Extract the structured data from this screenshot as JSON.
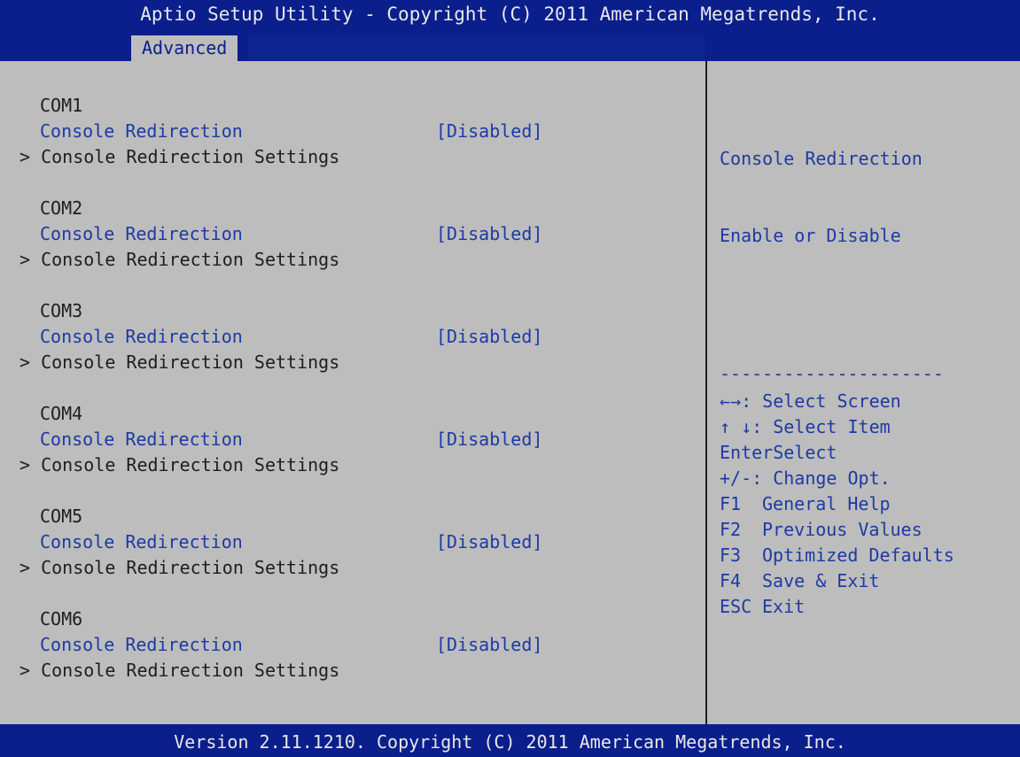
{
  "header": {
    "title": "Aptio Setup Utility - Copyright (C) 2011 American Megatrends, Inc.",
    "active_tab": "Advanced"
  },
  "groups": [
    {
      "com": "COM1",
      "option_label": "Console Redirection",
      "option_value": "[Disabled]",
      "submenu": "> Console Redirection Settings"
    },
    {
      "com": "COM2",
      "option_label": "Console Redirection",
      "option_value": "[Disabled]",
      "submenu": "> Console Redirection Settings"
    },
    {
      "com": "COM3",
      "option_label": "Console Redirection",
      "option_value": "[Disabled]",
      "submenu": "> Console Redirection Settings"
    },
    {
      "com": "COM4",
      "option_label": "Console Redirection",
      "option_value": "[Disabled]",
      "submenu": "> Console Redirection Settings"
    },
    {
      "com": "COM5",
      "option_label": "Console Redirection",
      "option_value": "[Disabled]",
      "submenu": "> Console Redirection Settings"
    },
    {
      "com": "COM6",
      "option_label": "Console Redirection",
      "option_value": "[Disabled]",
      "submenu": "> Console Redirection Settings"
    }
  ],
  "help": {
    "line1": "Console Redirection",
    "line2": "Enable or Disable"
  },
  "separator": "---------------------",
  "keys": [
    {
      "key": "←→",
      "desc": ": Select Screen"
    },
    {
      "key": "↑ ↓",
      "desc": ": Select Item"
    },
    {
      "key": "Enter",
      "desc": "Select"
    },
    {
      "key": "+/-",
      "desc": ": Change Opt."
    },
    {
      "key": "F1",
      "desc": "General Help"
    },
    {
      "key": "F2",
      "desc": "Previous Values"
    },
    {
      "key": "F3",
      "desc": "Optimized Defaults"
    },
    {
      "key": "F4",
      "desc": "Save & Exit"
    },
    {
      "key": "ESC",
      "desc": "Exit"
    }
  ],
  "footer": {
    "text": "Version 2.11.1210. Copyright (C) 2011 American Megatrends, Inc."
  }
}
